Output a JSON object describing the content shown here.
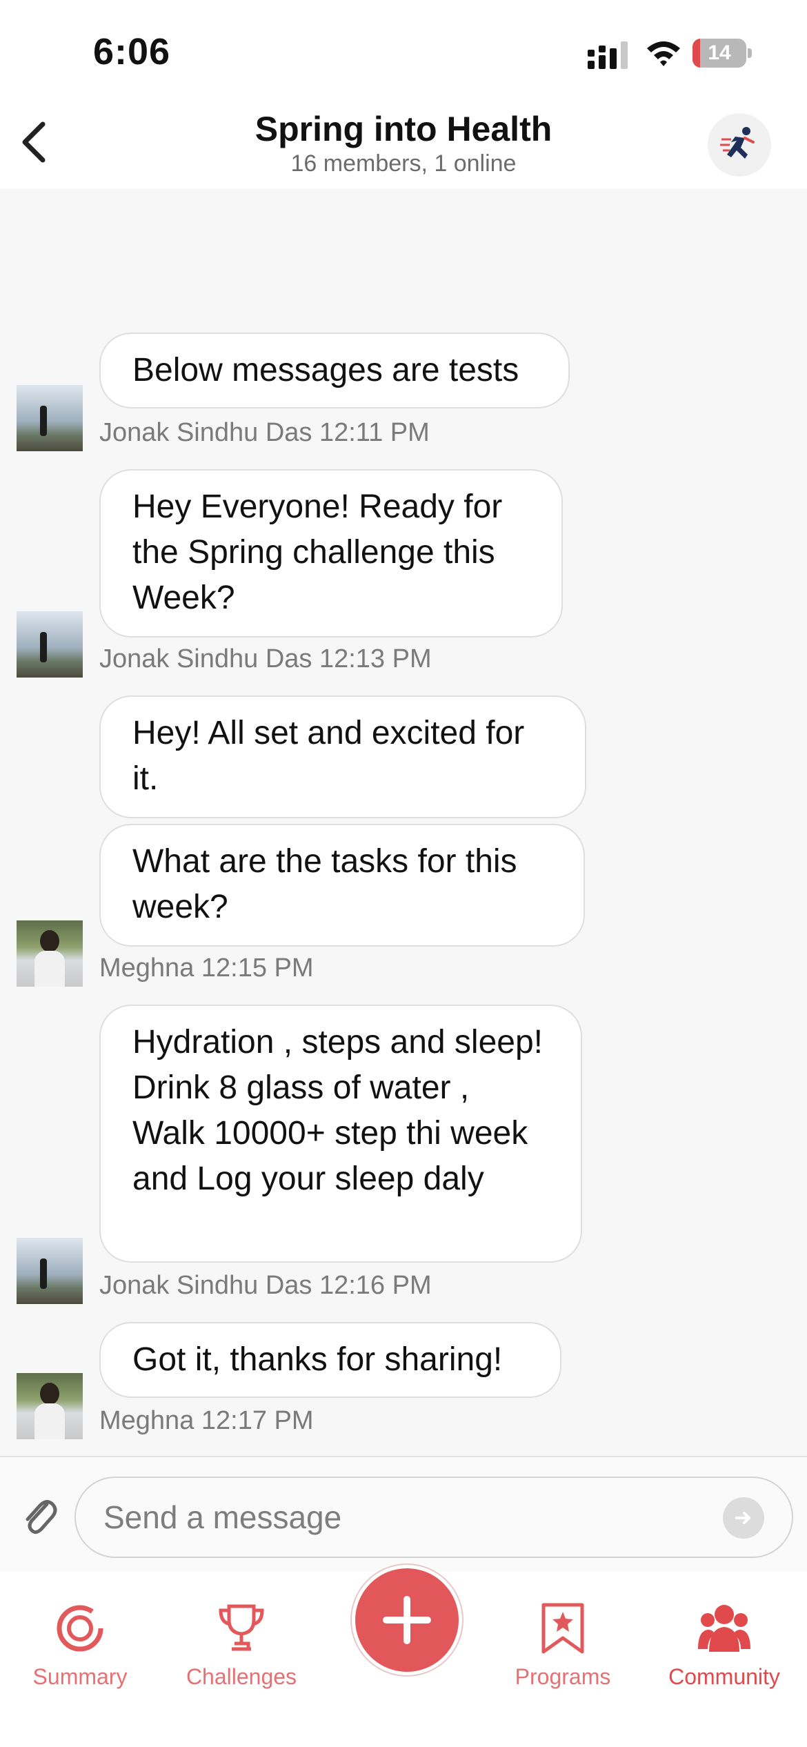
{
  "status": {
    "time": "6:06",
    "battery": "14",
    "battery_level": 0.14
  },
  "header": {
    "title": "Spring into Health",
    "subtitle": "16 members, 1 online",
    "back_icon": "chevron-left-icon",
    "group_icon": "runner-icon"
  },
  "messages": [
    {
      "text": "Below messages are tests",
      "meta": "Jonak Sindhu Das 12:11 PM",
      "avatar": "mountain"
    },
    {
      "text": "Hey Everyone! Ready for the Spring challenge this Week?",
      "meta": "Jonak Sindhu Das 12:13 PM",
      "avatar": "mountain"
    },
    {
      "text": "Hey! All set and excited for it."
    },
    {
      "text": "What are the tasks for this week?",
      "meta": "Meghna 12:15 PM",
      "avatar": "person"
    },
    {
      "text": "Hydration , steps and sleep! Drink 8  glass of water ,  Walk 10000+ step thi week and Log your sleep daly",
      "meta": "Jonak Sindhu Das 12:16 PM",
      "avatar": "mountain"
    },
    {
      "text": "Got it, thanks for sharing!",
      "meta": "Meghna 12:17 PM",
      "avatar": "person"
    }
  ],
  "composer": {
    "placeholder": "Send a message",
    "attach_icon": "paperclip-icon",
    "send_icon": "arrow-right-icon"
  },
  "tabs": [
    {
      "label": "Summary",
      "icon": "ring-icon"
    },
    {
      "label": "Challenges",
      "icon": "trophy-icon"
    },
    {
      "label": "",
      "icon": "plus-icon"
    },
    {
      "label": "Programs",
      "icon": "bookmark-star-icon"
    },
    {
      "label": "Community",
      "icon": "people-icon",
      "active": true
    }
  ],
  "colors": {
    "accent": "#e2585a",
    "background": "#f7f7f7",
    "bubble": "#ffffff"
  }
}
